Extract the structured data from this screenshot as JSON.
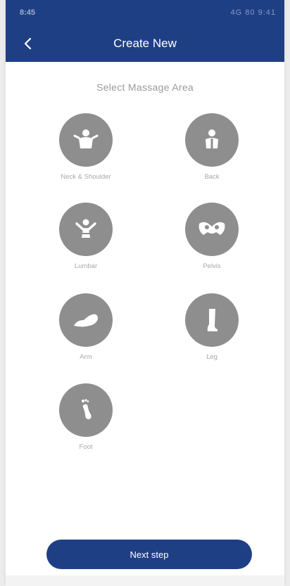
{
  "status_bar": {
    "left": "8:45",
    "right": "4G 80 9:41"
  },
  "header": {
    "title": "Create New",
    "back_icon": "chevron-left-icon"
  },
  "subtitle": "Select Massage Area",
  "areas": [
    {
      "label": "Neck & Shoulder",
      "icon": "neck-shoulder-icon"
    },
    {
      "label": "Back",
      "icon": "back-icon"
    },
    {
      "label": "Lumbar",
      "icon": "lumbar-icon"
    },
    {
      "label": "Pelvis",
      "icon": "pelvis-icon"
    },
    {
      "label": "Arm",
      "icon": "arm-icon"
    },
    {
      "label": "Leg",
      "icon": "leg-icon"
    },
    {
      "label": "Foot",
      "icon": "foot-icon"
    }
  ],
  "next_button": "Next step",
  "colors": {
    "primary": "#1f3f85",
    "icon_circle": "#8e8e8e",
    "label_text": "#a8a8a8"
  }
}
